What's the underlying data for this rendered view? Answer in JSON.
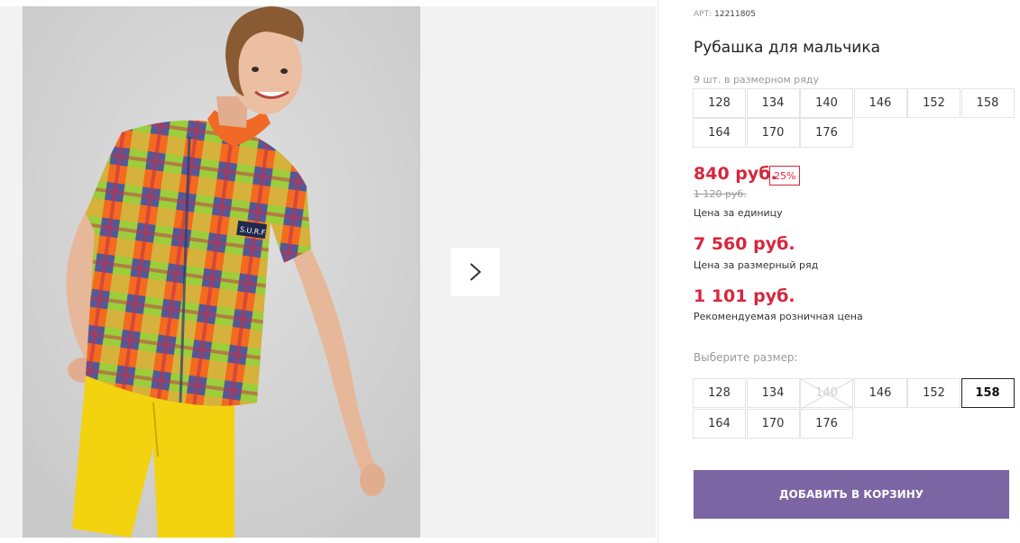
{
  "gallery": {
    "image_alt": "Мальчик в рубашке в клетку и жёлтых шортах",
    "pocket_patch": "S.U.R.F",
    "next_icon": "chevron-right-icon"
  },
  "product": {
    "art_label": "АРТ:",
    "art_number": "12211805",
    "title": "Рубашка для мальчика",
    "range_note": "9 шт. в размерном ряду",
    "range_sizes": [
      "128",
      "134",
      "140",
      "146",
      "152",
      "158",
      "164",
      "170",
      "176"
    ],
    "price": "840 руб.",
    "discount": "25%",
    "old_price": "1 120 руб.",
    "price_unit_label": "Цена за единицу",
    "range_price": "7 560 руб.",
    "range_price_label": "Цена за размерный ряд",
    "retail_price": "1 101 руб.",
    "retail_price_label": "Рекомендуемая розничная цена",
    "choose_size_label": "Выберите размер:",
    "sizes": [
      {
        "label": "128",
        "state": "available"
      },
      {
        "label": "134",
        "state": "available"
      },
      {
        "label": "140",
        "state": "unavailable"
      },
      {
        "label": "146",
        "state": "available"
      },
      {
        "label": "152",
        "state": "available"
      },
      {
        "label": "158",
        "state": "selected"
      },
      {
        "label": "164",
        "state": "available"
      },
      {
        "label": "170",
        "state": "available"
      },
      {
        "label": "176",
        "state": "available"
      }
    ],
    "add_to_cart_label": "ДОБАВИТЬ В КОРЗИНУ"
  },
  "colors": {
    "price_red": "#d7263d",
    "button_purple": "#7b65a3",
    "gallery_bg": "#f2f2f2"
  }
}
